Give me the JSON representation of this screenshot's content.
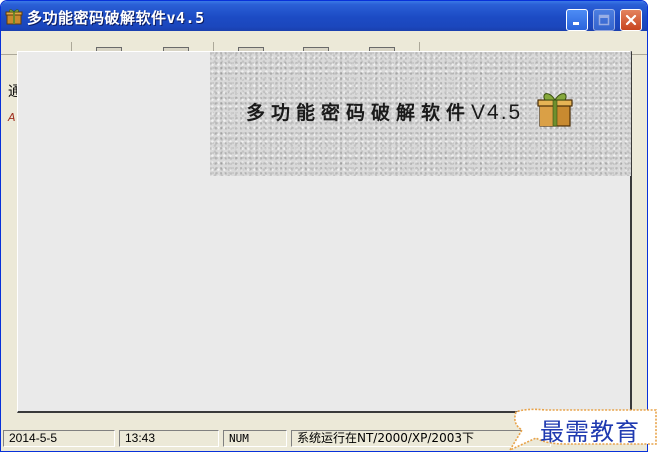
{
  "window": {
    "title": "多功能密码破解软件v4.5"
  },
  "background": {
    "glyph_1": "通",
    "glyph_2": "A"
  },
  "splash": {
    "banner_title": "多功能密码破解软件",
    "banner_version": "V4.5"
  },
  "statusbar": {
    "date": "2014-5-5",
    "time": "13:43",
    "num": "NUM",
    "message": "系统运行在NT/2000/XP/2003下"
  },
  "watermark": {
    "text": "最需教育"
  },
  "colors": {
    "titlebar": "#1c4bc4",
    "window_bg": "#ece9d8",
    "close_button": "#c8451f",
    "watermark_text": "#1f3ab0",
    "watermark_border": "#e8a34a"
  },
  "icons": {
    "app": "gift-box-icon",
    "minimize": "minimize-icon",
    "maximize": "maximize-icon",
    "close": "close-icon"
  }
}
